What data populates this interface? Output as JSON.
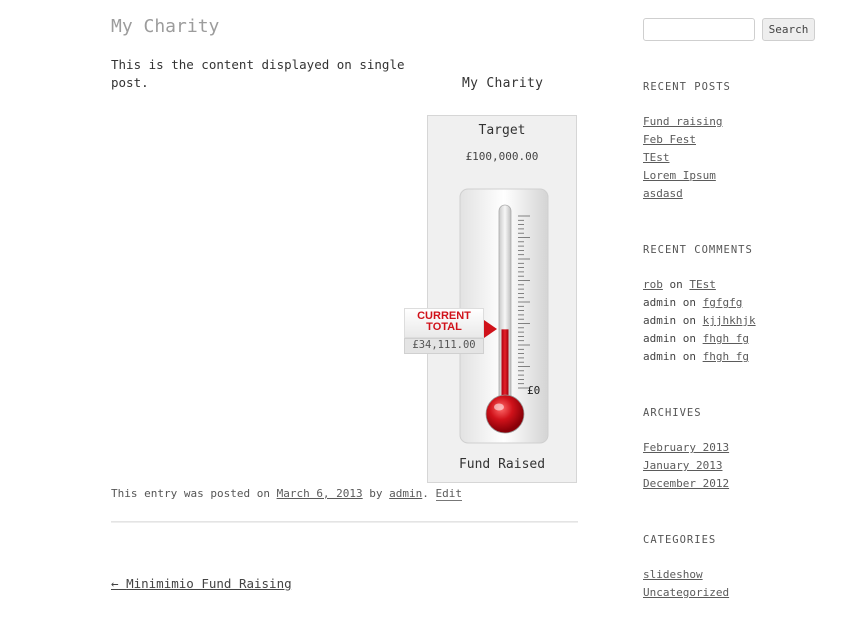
{
  "post": {
    "title": "My Charity",
    "content": "This is the content displayed on single post."
  },
  "thermometer": {
    "widget_title": "My Charity",
    "target_label": "Target",
    "target_value": "£100,000.00",
    "current_label_line1": "CURRENT",
    "current_label_line2": "TOTAL",
    "current_value": "£34,111.00",
    "scale_zero": "£0",
    "footer_label": "Fund Raised",
    "fill_fraction": 0.341,
    "fill_color": "#d0121a"
  },
  "entry_meta": {
    "prefix": "This entry was posted on",
    "date": "March 6, 2013",
    "by": "by",
    "author": "admin",
    "separator": ".",
    "edit": "Edit"
  },
  "navigation": {
    "prev_arrow": "←",
    "prev_label": "Minimimio Fund Raising"
  },
  "sidebar": {
    "search_button": "Search",
    "recent_posts": {
      "title": "RECENT POSTS",
      "items": [
        "Fund raising",
        "Feb Fest",
        "TEst",
        "Lorem Ipsum",
        "asdasd"
      ]
    },
    "recent_comments": {
      "title": "RECENT COMMENTS",
      "items": [
        {
          "author": "rob",
          "on": "on",
          "post": "TEst"
        },
        {
          "author": "admin",
          "on": "on",
          "post": "fgfgfg"
        },
        {
          "author": "admin",
          "on": "on",
          "post": "kjjhkhjk"
        },
        {
          "author": "admin",
          "on": "on",
          "post": "fhgh fg"
        },
        {
          "author": "admin",
          "on": "on",
          "post": "fhgh fg"
        }
      ]
    },
    "archives": {
      "title": "ARCHIVES",
      "items": [
        "February 2013",
        "January 2013",
        "December 2012"
      ]
    },
    "categories": {
      "title": "CATEGORIES",
      "items": [
        "slideshow",
        "Uncategorized"
      ]
    }
  }
}
